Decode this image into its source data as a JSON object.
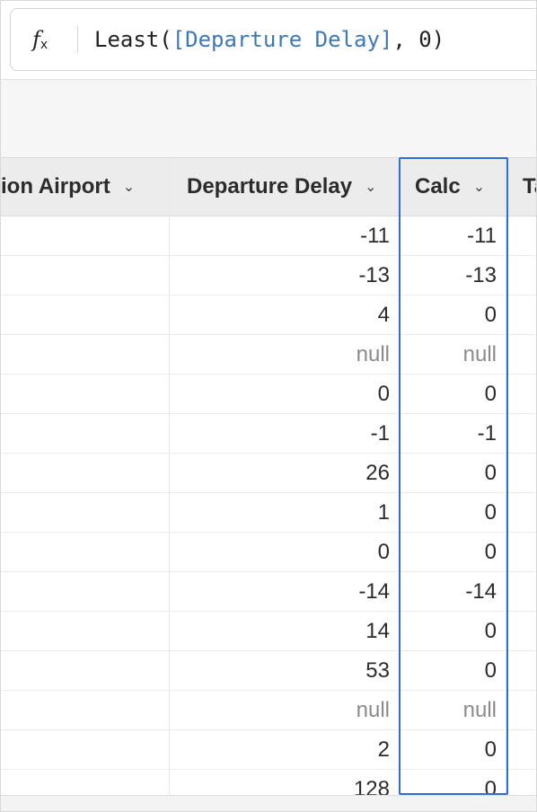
{
  "formula": {
    "icon": "fx-icon",
    "fx_letter": "f",
    "fx_sub": "x",
    "function_name": "Least(",
    "reference": "[Departure Delay]",
    "rest": ", 0)"
  },
  "columns": [
    {
      "key": "airport",
      "label": "tion Airport"
    },
    {
      "key": "departure_delay",
      "label": "Departure Delay"
    },
    {
      "key": "calc",
      "label": "Calc"
    },
    {
      "key": "next",
      "label": "Ta"
    }
  ],
  "chevron_glyph": "⌄",
  "rows": [
    {
      "departure_delay": "-11",
      "calc": "-11"
    },
    {
      "departure_delay": "-13",
      "calc": "-13"
    },
    {
      "departure_delay": "4",
      "calc": "0"
    },
    {
      "departure_delay": "null",
      "calc": "null"
    },
    {
      "departure_delay": "0",
      "calc": "0"
    },
    {
      "departure_delay": "-1",
      "calc": "-1"
    },
    {
      "departure_delay": "26",
      "calc": "0"
    },
    {
      "departure_delay": "1",
      "calc": "0"
    },
    {
      "departure_delay": "0",
      "calc": "0"
    },
    {
      "departure_delay": "-14",
      "calc": "-14"
    },
    {
      "departure_delay": "14",
      "calc": "0"
    },
    {
      "departure_delay": "53",
      "calc": "0"
    },
    {
      "departure_delay": "null",
      "calc": "null"
    },
    {
      "departure_delay": "2",
      "calc": "0"
    },
    {
      "departure_delay": "128",
      "calc": "0"
    }
  ],
  "colors": {
    "selection": "#2f6fd3",
    "formula_reference": "#3d78b8",
    "null_text": "#8a8a8a"
  }
}
